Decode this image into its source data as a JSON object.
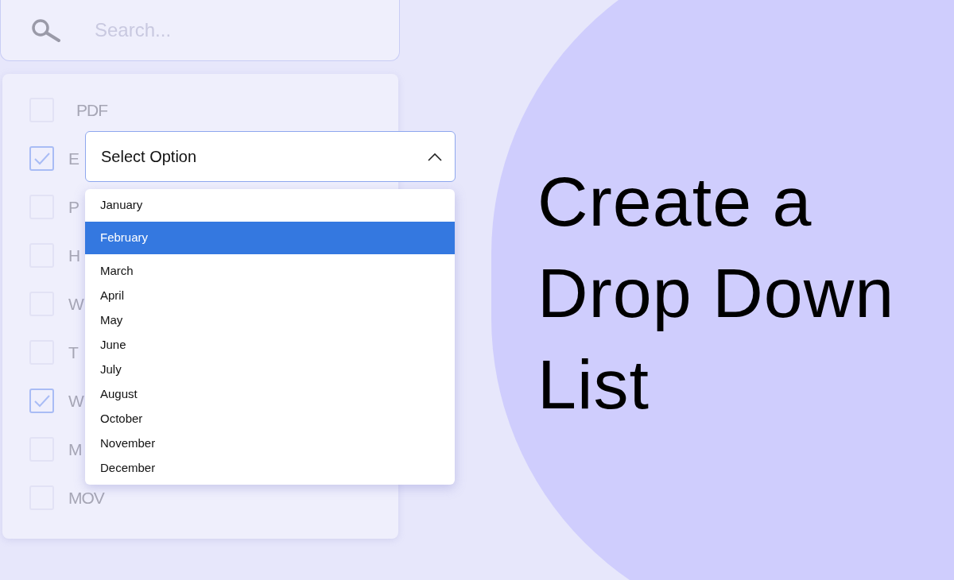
{
  "search": {
    "placeholder": "Search..."
  },
  "checklist": [
    {
      "label": "PDF",
      "checked": false
    },
    {
      "label": "E",
      "checked": true
    },
    {
      "label": "P",
      "checked": false
    },
    {
      "label": "H",
      "checked": false
    },
    {
      "label": "W",
      "checked": false
    },
    {
      "label": "T",
      "checked": false
    },
    {
      "label": "W",
      "checked": true
    },
    {
      "label": "M",
      "checked": false
    },
    {
      "label": "MOV",
      "checked": false
    }
  ],
  "dropdown": {
    "value": "Select Option",
    "expanded": true,
    "options": [
      {
        "label": "January",
        "selected": false
      },
      {
        "label": "February",
        "selected": true
      },
      {
        "label": "March",
        "selected": false
      },
      {
        "label": "April",
        "selected": false
      },
      {
        "label": "May",
        "selected": false
      },
      {
        "label": "June",
        "selected": false
      },
      {
        "label": "July",
        "selected": false
      },
      {
        "label": "August",
        "selected": false
      },
      {
        "label": "October",
        "selected": false
      },
      {
        "label": "November",
        "selected": false
      },
      {
        "label": "December",
        "selected": false
      }
    ]
  },
  "headline": [
    "Create a",
    "Drop Down",
    "List"
  ]
}
